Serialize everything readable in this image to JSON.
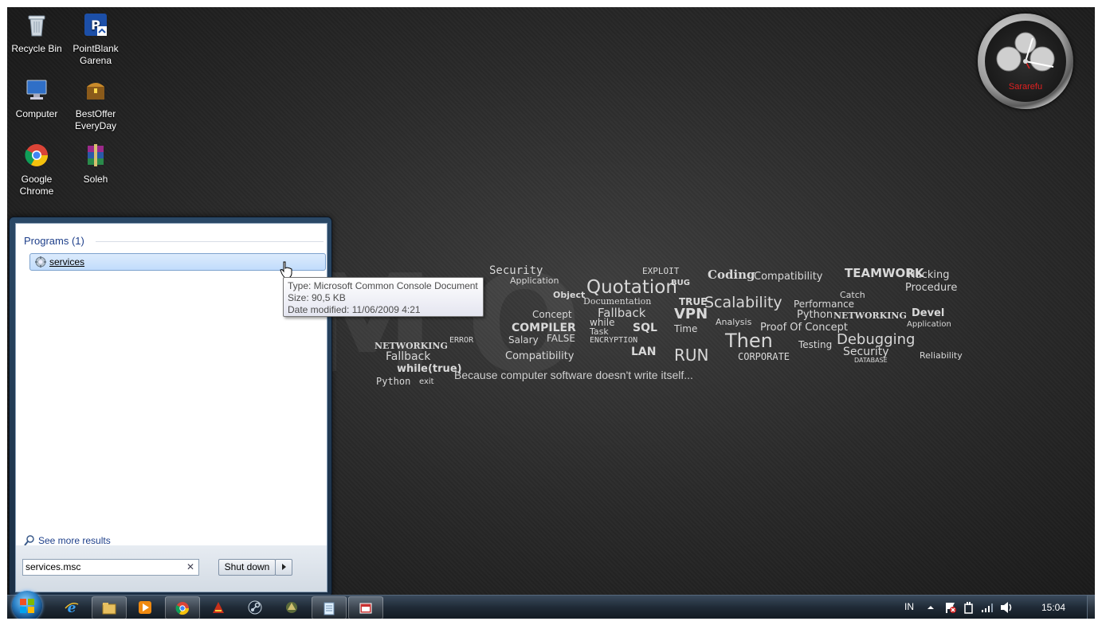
{
  "desktop": {
    "watermark": "DEMO",
    "watermark_tail": "ON",
    "tagline": "Because computer software doesn't write itself...",
    "icons": [
      {
        "label": "Recycle Bin"
      },
      {
        "label": "PointBlank Garena"
      },
      {
        "label": "Computer"
      },
      {
        "label": "BestOffer EveryDay"
      },
      {
        "label": "Google Chrome"
      },
      {
        "label": "Soleh"
      }
    ],
    "words": [
      "Security",
      "Application",
      "Quotation",
      "BUG",
      "Coding",
      "Compatibility",
      "TEAMWORK",
      "Hacking",
      "Procedure",
      "EXPLOIT",
      "Documentation",
      "TRUE",
      "Scalability",
      "Performance",
      "Catch",
      "Object",
      "Fallback",
      "VPN",
      "Python",
      "NETWORKING",
      "Devel",
      "Concept",
      "Analysis",
      "Proof Of Concept",
      "Application",
      "COMPILER",
      "while",
      "SQL",
      "Time",
      "Salary",
      "FALSE",
      "ENCRYPTION",
      "Then",
      "Debugging",
      "Security",
      "NETWORKING",
      "Fallback",
      "Compatibility",
      "LAN",
      "RUN",
      "CORPORATE",
      "Testing",
      "while(true)",
      "Python",
      "exit",
      "ERROR",
      "Task",
      "Reliability",
      "DATABASE"
    ],
    "clock_brand": "Sararefu"
  },
  "start_menu": {
    "programs_header": "Programs (1)",
    "results": [
      {
        "label": "services"
      }
    ],
    "see_more": "See more results",
    "search_value": "services.msc",
    "shutdown_label": "Shut down"
  },
  "tooltip": {
    "type_line": "Type: Microsoft Common Console Document",
    "size_line": "Size: 90,5 KB",
    "date_line": "Date modified: 11/06/2009 4:21"
  },
  "taskbar": {
    "language": "IN",
    "time": "15:04",
    "pinned": [
      "internet-explorer",
      "file-explorer",
      "media-player",
      "chrome",
      "app-red",
      "steam",
      "app-game",
      "notepad",
      "app-red-window"
    ]
  },
  "colors": {
    "selection": "#c1dcfc",
    "link_blue": "#1e3f8a",
    "clock_brand": "#e02020"
  }
}
